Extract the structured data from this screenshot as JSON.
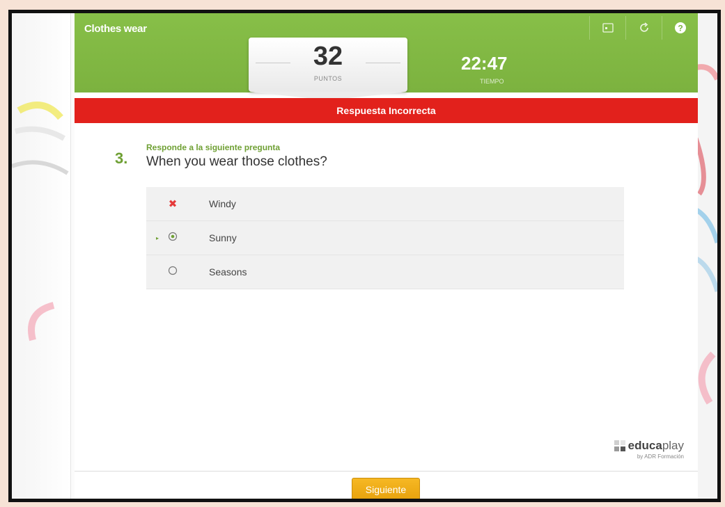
{
  "header": {
    "title": "Clothes wear",
    "icons": [
      "fullscreen-icon",
      "refresh-icon",
      "help-icon"
    ]
  },
  "score": {
    "value": "32",
    "label": "PUNTOS"
  },
  "timer": {
    "value": "22:47",
    "label": "TIEMPO"
  },
  "result": {
    "text": "Respuesta Incorrecta",
    "color": "#e2211c"
  },
  "question": {
    "number": "3.",
    "instruction": "Responde a la siguiente pregunta",
    "text": "When you wear those clothes?",
    "options": [
      {
        "label": "Windy",
        "state": "wrong"
      },
      {
        "label": "Sunny",
        "state": "correct"
      },
      {
        "label": "Seasons",
        "state": "unselected"
      }
    ]
  },
  "brand": {
    "name_bold": "educa",
    "name_light": "play",
    "subtitle": "by ADR Formación"
  },
  "footer": {
    "next_label": "Siguiente"
  },
  "colors": {
    "accent_green": "#7cb23f",
    "button_orange": "#f0ad17"
  }
}
